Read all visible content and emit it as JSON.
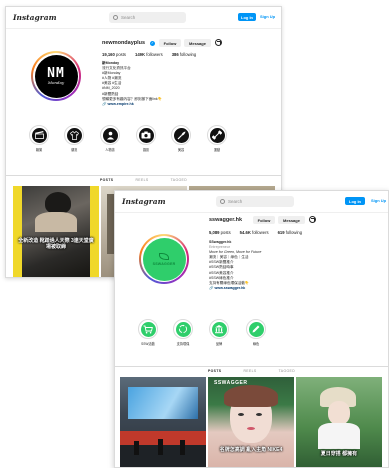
{
  "nav": {
    "logo": "Instagram",
    "search_placeholder": "Search",
    "login": "Log In",
    "signup": "Sign Up"
  },
  "profile_a": {
    "username": "newmondayplus",
    "follow": "Follow",
    "message": "Message",
    "stats": {
      "posts": "19,160",
      "posts_label": "posts",
      "followers": "149K",
      "followers_label": "followers",
      "following": "386",
      "following_label": "following"
    },
    "avatar_text": "NM",
    "avatar_sub": "Monday",
    "bio": {
      "name": "新Monday",
      "line1": "流行文化資訊平台",
      "line2": "#新Monday",
      "line3": "#人物 #潮流",
      "line4": "#美容 #生活",
      "line5": "#NM_2020",
      "line6": "#新聞熱話",
      "line7": "想睇更多有趣內容？即刻撳下面link👇",
      "link": "www.empire.hk"
    },
    "highlights": [
      "娛樂",
      "潮流",
      "人物誌",
      "攝影",
      "美容",
      "運動"
    ],
    "tabs": [
      "POSTS",
      "REELS",
      "TAGGED"
    ],
    "tile_caption": "全新改造 靴踏過人天際 3連天堂廣場被取締"
  },
  "profile_b": {
    "username": "sswagger.hk",
    "follow": "Follow",
    "message": "Message",
    "stats": {
      "posts": "5,089",
      "posts_label": "posts",
      "followers": "54.6K",
      "followers_label": "followers",
      "following": "619",
      "following_label": "following"
    },
    "avatar_text": "SSWAGGER",
    "bio": {
      "name": "SSwagger.hk",
      "category": "Entrepreneur",
      "line1": "Move for Green, Move for Future",
      "line2": "潮流｜美容｜綠色｜生活",
      "line3": "#SSW新聞推介",
      "line4": "#SSW熱話時事",
      "line5": "#SSW美容推介",
      "line6": "#SSW綠色推介",
      "line7": "支持有關綠色環保活動👇",
      "link": "www.sswagger.hk"
    },
    "highlights": [
      "SSW活動",
      "支持環保",
      "品牌",
      "綠色"
    ],
    "tabs": [
      "POSTS",
      "REELS",
      "TAGGED"
    ],
    "tile_label": "SSWAGGER",
    "tile_caption_1": "名牌怎高調 亂入主角 NIKE4",
    "tile_caption_2": "夏日穿搭 都擁有"
  },
  "colors": {
    "blue": "#0095f6",
    "green": "#2fce6b",
    "dark_green": "#0f8a3d",
    "yellow": "#f0d82a"
  }
}
